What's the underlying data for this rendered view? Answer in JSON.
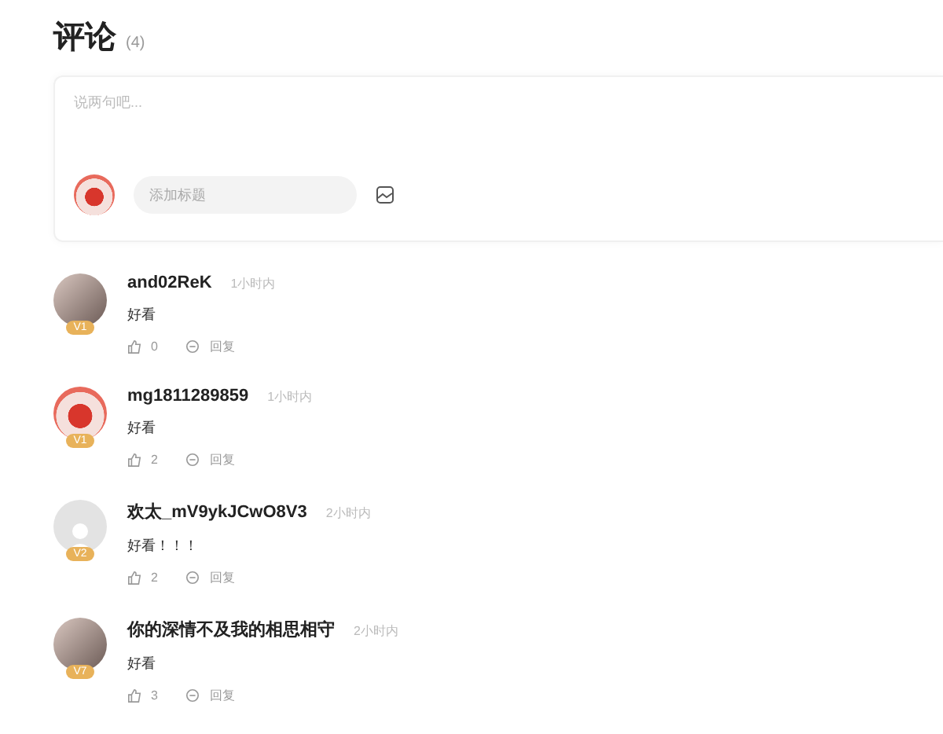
{
  "header": {
    "title": "评论",
    "count": "(4)"
  },
  "composer": {
    "placeholder": "说两句吧...",
    "title_field": {
      "placeholder": "添加标题"
    }
  },
  "comments": [
    {
      "author": "and02ReK",
      "time": "1小时内",
      "text": "好看",
      "badge": "V1",
      "default_avatar": false,
      "likes": "0",
      "reply": "回复"
    },
    {
      "author": "mg1811289859",
      "time": "1小时内",
      "text": "好看",
      "badge": "V1",
      "default_avatar": false,
      "likes": "2",
      "reply": "回复"
    },
    {
      "author": "欢太_mV9ykJCwO8V3",
      "time": "2小时内",
      "text": "好看！！！",
      "badge": "V2",
      "default_avatar": true,
      "likes": "2",
      "reply": "回复"
    },
    {
      "author": "你的深情不及我的相思相守",
      "time": "2小时内",
      "text": "好看",
      "badge": "V7",
      "default_avatar": false,
      "likes": "3",
      "reply": "回复"
    }
  ]
}
